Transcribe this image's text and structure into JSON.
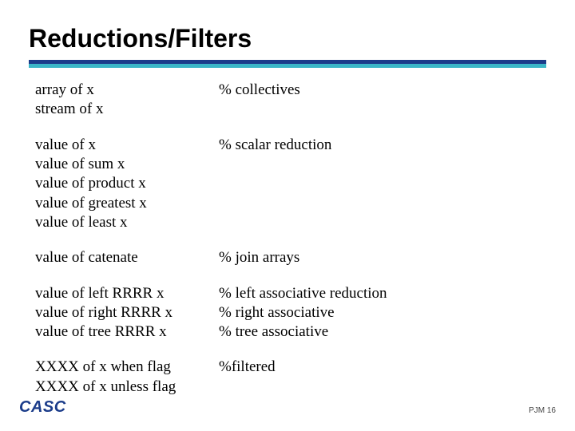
{
  "title": "Reductions/Filters",
  "blocks": [
    {
      "left": "array of x\nstream of x",
      "right": "% collectives"
    },
    {
      "left": "value of x\nvalue of sum x\nvalue of product x\nvalue of greatest x\nvalue of least x",
      "right": "% scalar reduction"
    },
    {
      "left": "value of catenate",
      "right": "% join arrays"
    },
    {
      "left": "value of left   RRRR x\nvalue of right RRRR x\nvalue of tree  RRRR x",
      "right": "% left associative reduction\n% right associative\n% tree associative"
    },
    {
      "left": "XXXX of x when flag\nXXXX of x unless flag",
      "right": "%filtered"
    }
  ],
  "footer": {
    "left": "CASC",
    "right": "PJM  16"
  }
}
